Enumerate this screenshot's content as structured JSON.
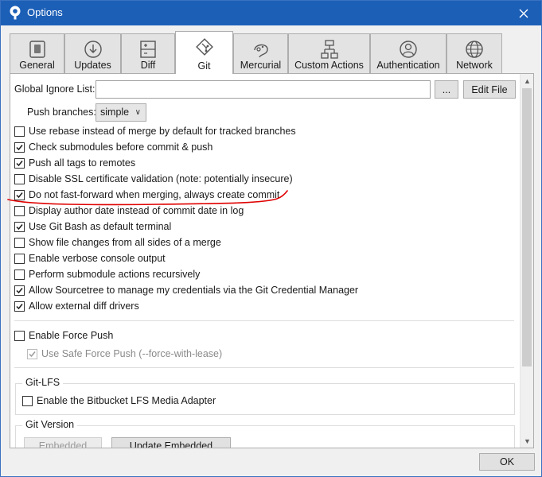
{
  "window": {
    "title": "Options",
    "close_label": "✕"
  },
  "tabs": [
    {
      "label": "General",
      "icon": "switch-icon",
      "active": false
    },
    {
      "label": "Updates",
      "icon": "download-icon",
      "active": false
    },
    {
      "label": "Diff",
      "icon": "diff-icon",
      "active": false
    },
    {
      "label": "Git",
      "icon": "git-icon",
      "active": true
    },
    {
      "label": "Mercurial",
      "icon": "mercurial-icon",
      "active": false
    },
    {
      "label": "Custom Actions",
      "icon": "flow-icon",
      "active": false
    },
    {
      "label": "Authentication",
      "icon": "user-icon",
      "active": false
    },
    {
      "label": "Network",
      "icon": "globe-icon",
      "active": false
    }
  ],
  "git": {
    "global_ignore_label": "Global Ignore List:",
    "global_ignore_value": "",
    "browse_label": "...",
    "edit_file_label": "Edit File",
    "push_branches_label": "Push branches:",
    "push_branches_value": "simple",
    "options": [
      {
        "label": "Use rebase instead of merge by default for tracked branches",
        "checked": false
      },
      {
        "label": "Check submodules before commit & push",
        "checked": true
      },
      {
        "label": "Push all tags to remotes",
        "checked": true
      },
      {
        "label": "Disable SSL certificate validation (note: potentially insecure)",
        "checked": false
      },
      {
        "label": "Do not fast-forward when merging, always create commit",
        "checked": true
      },
      {
        "label": "Display author date instead of commit date in log",
        "checked": false
      },
      {
        "label": "Use Git Bash as default terminal",
        "checked": true
      },
      {
        "label": "Show file changes from all sides of a merge",
        "checked": false
      },
      {
        "label": "Enable verbose console output",
        "checked": false
      },
      {
        "label": "Perform submodule actions recursively",
        "checked": false
      },
      {
        "label": "Allow Sourcetree to manage my credentials via the Git Credential Manager",
        "checked": true
      },
      {
        "label": "Allow external diff drivers",
        "checked": true
      }
    ],
    "force_push_label": "Enable Force Push",
    "force_push_checked": false,
    "safe_force_push_label": "Use Safe Force Push (--force-with-lease)",
    "safe_force_push_checked": true,
    "lfs_group_title": "Git-LFS",
    "lfs_label": "Enable the Bitbucket LFS Media Adapter",
    "lfs_checked": false,
    "version_group_title": "Git Version",
    "embedded_label": "Embedded",
    "update_embedded_label": "Update Embedded"
  },
  "footer": {
    "ok_label": "OK"
  },
  "colors": {
    "titlebar": "#1c5fb7",
    "annotation": "#e00000"
  }
}
